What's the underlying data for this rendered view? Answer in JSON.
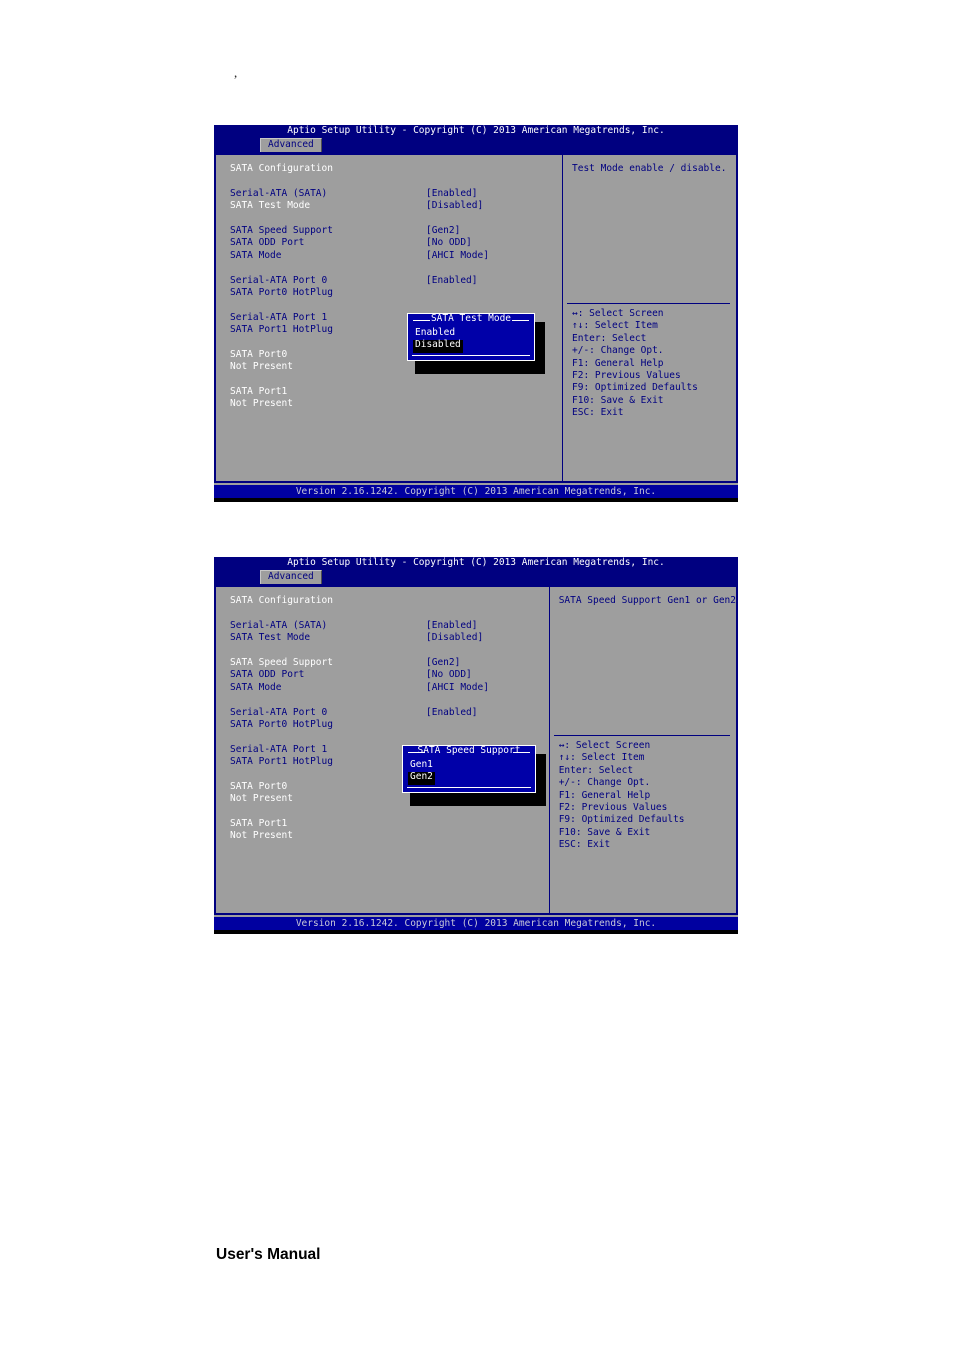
{
  "page": {
    "stray_mark": ",",
    "footer_label": "User's Manual"
  },
  "screen1": {
    "title": "Aptio Setup Utility - Copyright (C) 2013 American Megatrends, Inc.",
    "tab": "Advanced",
    "section_heading": "SATA Configuration",
    "items": [
      {
        "label": "Serial-ATA (SATA)",
        "value": "[Enabled]",
        "style": "blue"
      },
      {
        "label": "SATA Test Mode",
        "value": "[Disabled]",
        "style": "white"
      },
      {
        "label": "SATA Speed Support",
        "value": "[Gen2]",
        "style": "blue"
      },
      {
        "label": "SATA ODD Port",
        "value": "[No ODD]",
        "style": "blue"
      },
      {
        "label": "SATA Mode",
        "value": "[AHCI Mode]",
        "style": "blue"
      },
      {
        "label": "Serial-ATA Port 0",
        "value": "[Enabled]",
        "style": "blue"
      },
      {
        "label": "SATA Port0 HotPlug",
        "value": "",
        "style": "blue"
      },
      {
        "label": "Serial-ATA Port 1",
        "value": "",
        "style": "blue"
      },
      {
        "label": "SATA Port1 HotPlug",
        "value": "",
        "style": "blue"
      },
      {
        "label": "SATA Port0",
        "value": "",
        "style": "dark"
      },
      {
        "label": "Not Present",
        "value": "",
        "style": "dark"
      },
      {
        "label": "SATA Port1",
        "value": "",
        "style": "dark"
      },
      {
        "label": "Not Present",
        "value": "",
        "style": "dark"
      }
    ],
    "help_text": "Test Mode enable / disable.",
    "legend": [
      "↔: Select Screen",
      "↑↓: Select Item",
      "Enter: Select",
      "+/-: Change Opt.",
      "F1: General Help",
      "F2: Previous Values",
      "F9: Optimized Defaults",
      "F10: Save & Exit",
      "ESC: Exit"
    ],
    "popup": {
      "title": "SATA Test Mode",
      "options": [
        "Enabled",
        "Disabled"
      ],
      "selected": "Disabled"
    },
    "footer": "Version 2.16.1242. Copyright (C) 2013 American Megatrends, Inc."
  },
  "screen2": {
    "title": "Aptio Setup Utility - Copyright (C) 2013 American Megatrends, Inc.",
    "tab": "Advanced",
    "section_heading": "SATA Configuration",
    "items": [
      {
        "label": "Serial-ATA (SATA)",
        "value": "[Enabled]",
        "style": "blue"
      },
      {
        "label": "SATA Test Mode",
        "value": "[Disabled]",
        "style": "blue"
      },
      {
        "label": "SATA Speed Support",
        "value": "[Gen2]",
        "style": "white"
      },
      {
        "label": "SATA ODD Port",
        "value": "[No ODD]",
        "style": "blue"
      },
      {
        "label": "SATA Mode",
        "value": "[AHCI Mode]",
        "style": "blue"
      },
      {
        "label": "Serial-ATA Port 0",
        "value": "[Enabled]",
        "style": "blue"
      },
      {
        "label": "SATA Port0 HotPlug",
        "value": "",
        "style": "blue"
      },
      {
        "label": "Serial-ATA Port 1",
        "value": "",
        "style": "blue"
      },
      {
        "label": "SATA Port1 HotPlug",
        "value": "",
        "style": "blue"
      },
      {
        "label": "SATA Port0",
        "value": "",
        "style": "dark"
      },
      {
        "label": "Not Present",
        "value": "",
        "style": "dark"
      },
      {
        "label": "SATA Port1",
        "value": "",
        "style": "dark"
      },
      {
        "label": "Not Present",
        "value": "",
        "style": "dark"
      }
    ],
    "help_text": "SATA Speed Support Gen1 or Gen2",
    "legend": [
      "↔: Select Screen",
      "↑↓: Select Item",
      "Enter: Select",
      "+/-: Change Opt.",
      "F1: General Help",
      "F2: Previous Values",
      "F9: Optimized Defaults",
      "F10: Save & Exit",
      "ESC: Exit"
    ],
    "popup": {
      "title": "SATA Speed Support",
      "options": [
        "Gen1",
        "Gen2"
      ],
      "selected": "Gen2"
    },
    "footer": "Version 2.16.1242. Copyright (C) 2013 American Megatrends, Inc."
  },
  "colors": {
    "bios_blue": "#000080",
    "bios_gray": "#9e9e9e",
    "popup_blue": "#0000a8",
    "highlight": "#000000"
  }
}
